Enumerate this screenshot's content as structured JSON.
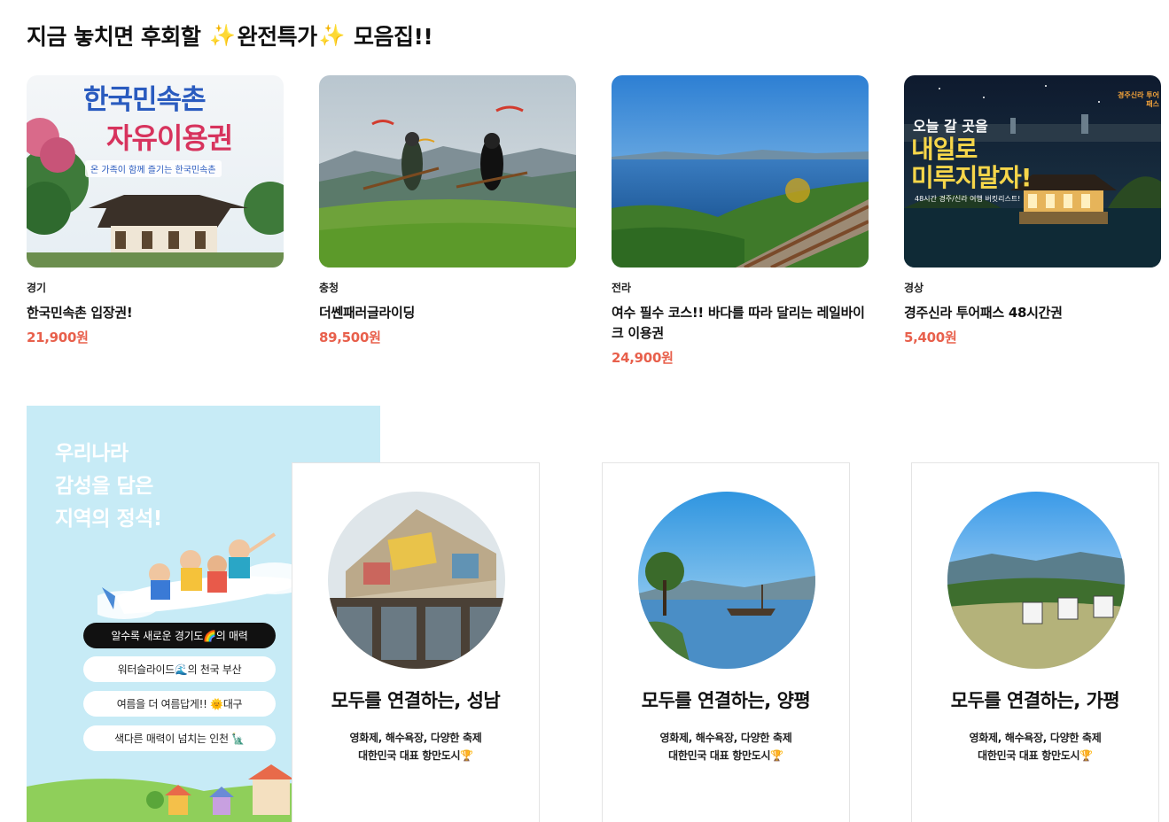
{
  "section": {
    "title_part1": "지금 놓치면 후회할",
    "title_part2": "완전특가",
    "title_part3": "모음집!!",
    "sparkle_icon": "sparkles-icon"
  },
  "deals": [
    {
      "region": "경기",
      "name": "한국민속촌 입장권!",
      "price": "21,900원",
      "thumb_text1": "한국민속촌",
      "thumb_text2": "자유이용권",
      "thumb_text3": "온 가족이 함께 즐기는 한국민속촌"
    },
    {
      "region": "충청",
      "name": "더쎈패러글라이딩",
      "price": "89,500원"
    },
    {
      "region": "전라",
      "name": "여수 필수 코스!! 바다를 따라 달리는 레일바이크 이용권",
      "price": "24,900원"
    },
    {
      "region": "경상",
      "name": "경주신라 투어패스 48시간권",
      "price": "5,400원",
      "thumb_text1": "오늘 갈 곳을",
      "thumb_text2": "내일로",
      "thumb_text3": "미루지말자!",
      "thumb_text4": "48시간 경주/신라 여행 버킷리스트!",
      "thumb_logo": "경주신라 투어패스"
    }
  ],
  "promo": {
    "headline_line1": "우리나라",
    "headline_line2": "감성을 담은",
    "headline_line3": "지역의 정석!",
    "pills": [
      {
        "label": "알수록 새로운 경기도🌈의 매력",
        "active": true
      },
      {
        "label": "워터슬라이드🌊의 천국 부산",
        "active": false
      },
      {
        "label": "여름을 더 여름답게!! 🌞대구",
        "active": false
      },
      {
        "label": "색다른 매력이 넘치는 인천 🗽",
        "active": false
      }
    ]
  },
  "region_cards": [
    {
      "title": "모두를 연결하는, 성남",
      "desc_line1": "영화제, 해수욕장, 다양한 축제",
      "desc_line2": "대한민국 대표 항만도시🏆"
    },
    {
      "title": "모두를 연결하는, 양평",
      "desc_line1": "영화제, 해수욕장, 다양한 축제",
      "desc_line2": "대한민국 대표 항만도시🏆"
    },
    {
      "title": "모두를 연결하는, 가평",
      "desc_line1": "영화제, 해수욕장, 다양한 축제",
      "desc_line2": "대한민국 대표 항만도시🏆"
    }
  ],
  "colors": {
    "price": "#e8604c",
    "promo_bg": "#c7ebf6",
    "pill_active_bg": "#111111"
  }
}
